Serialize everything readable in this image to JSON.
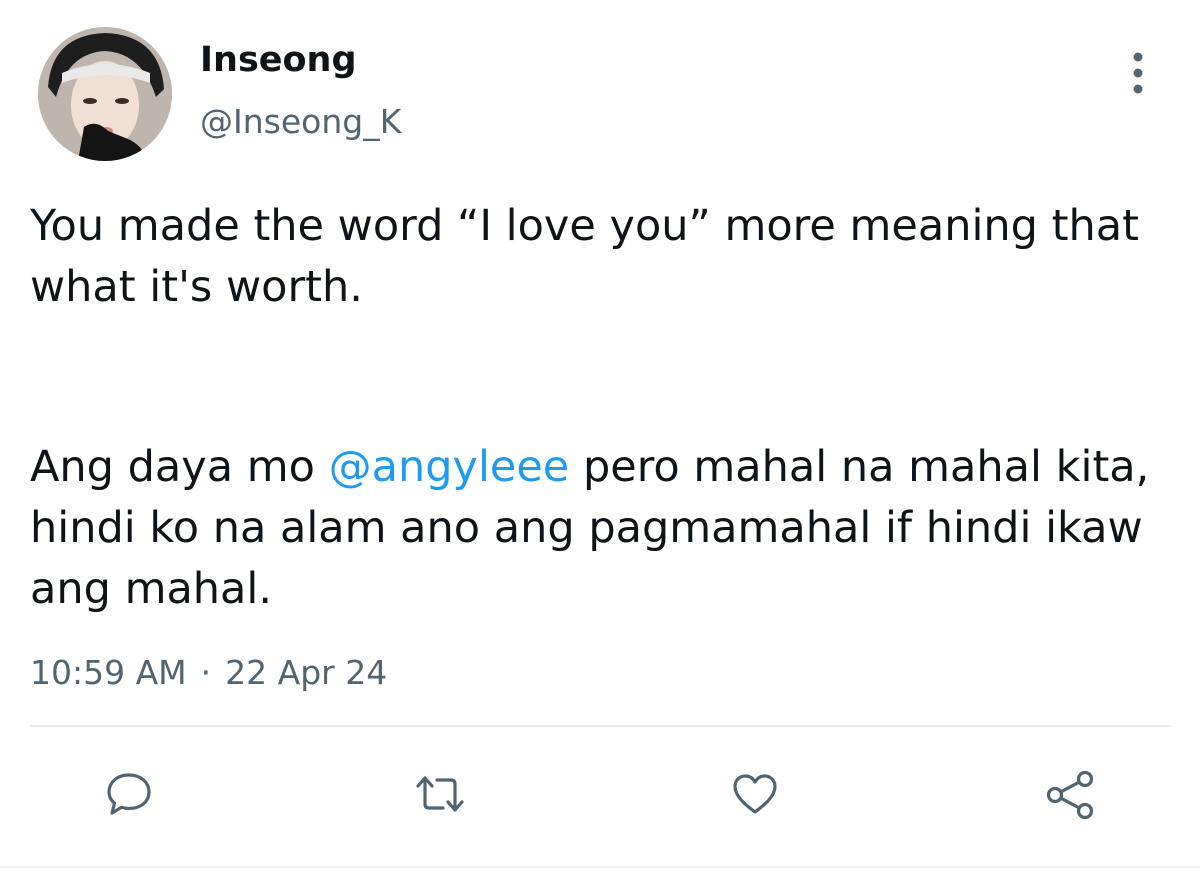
{
  "tweet": {
    "author": {
      "display_name": "Inseong",
      "handle": "@Inseong_K"
    },
    "paragraphs": [
      {
        "before": "You made the word “I love you” more meaning that what it's worth.",
        "mention": "",
        "after": ""
      },
      {
        "before": "Ang daya mo ",
        "mention": "@angyleee",
        "after": " pero mahal na mahal kita, hindi ko na alam ano ang pagmamahal if hindi ikaw ang mahal."
      }
    ],
    "time": "10:59 AM",
    "separator": "·",
    "date": "22 Apr 24"
  },
  "actions": {
    "reply_icon": "reply-icon",
    "retweet_icon": "retweet-icon",
    "like_icon": "heart-icon",
    "share_icon": "share-icon",
    "more_icon": "more-vertical-icon"
  },
  "colors": {
    "text": "#0f1419",
    "secondary": "#536471",
    "link": "#1d9bf0"
  }
}
